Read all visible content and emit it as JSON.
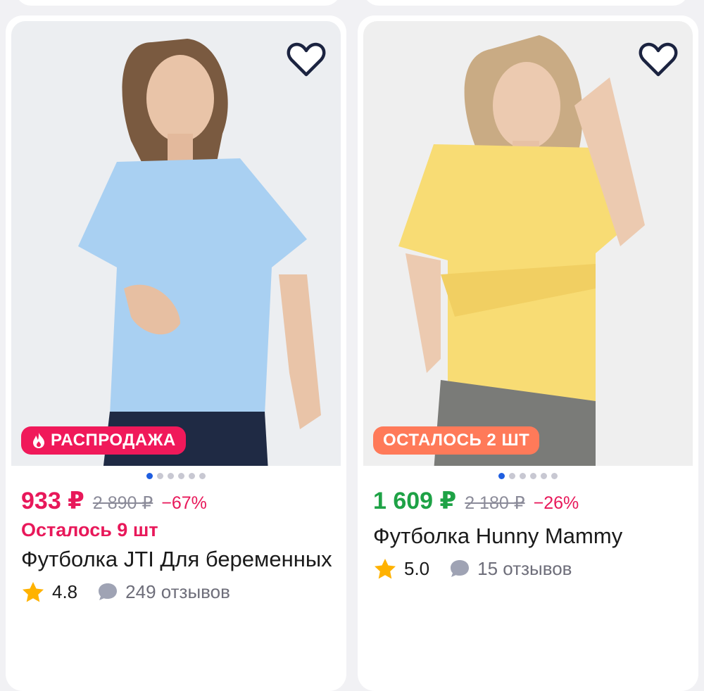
{
  "colors": {
    "sale_price": "#e8185a",
    "green_price": "#1ea246",
    "discount": "#e8185a",
    "badge_sale": "#f0195a",
    "badge_left": "#ff7a59",
    "dot_active": "#1f5ee0",
    "star": "#ffb200"
  },
  "products": [
    {
      "favorite_icon": "heart-outline-icon",
      "badge_icon": "fire-icon",
      "badge": "РАСПРОДАЖА",
      "price": "933 ₽",
      "old_price": "2 890 ₽",
      "discount": "−67%",
      "stock": "Осталось 9 шт",
      "title": "Футболка JTI Для беременных",
      "rating": "4.8",
      "reviews": "249 отзывов"
    },
    {
      "favorite_icon": "heart-outline-icon",
      "badge": "ОСТАЛОСЬ 2 ШТ",
      "price": "1 609 ₽",
      "old_price": "2 180 ₽",
      "discount": "−26%",
      "title": "Футболка Hunny Mammy",
      "rating": "5.0",
      "reviews": "15 отзывов"
    }
  ]
}
